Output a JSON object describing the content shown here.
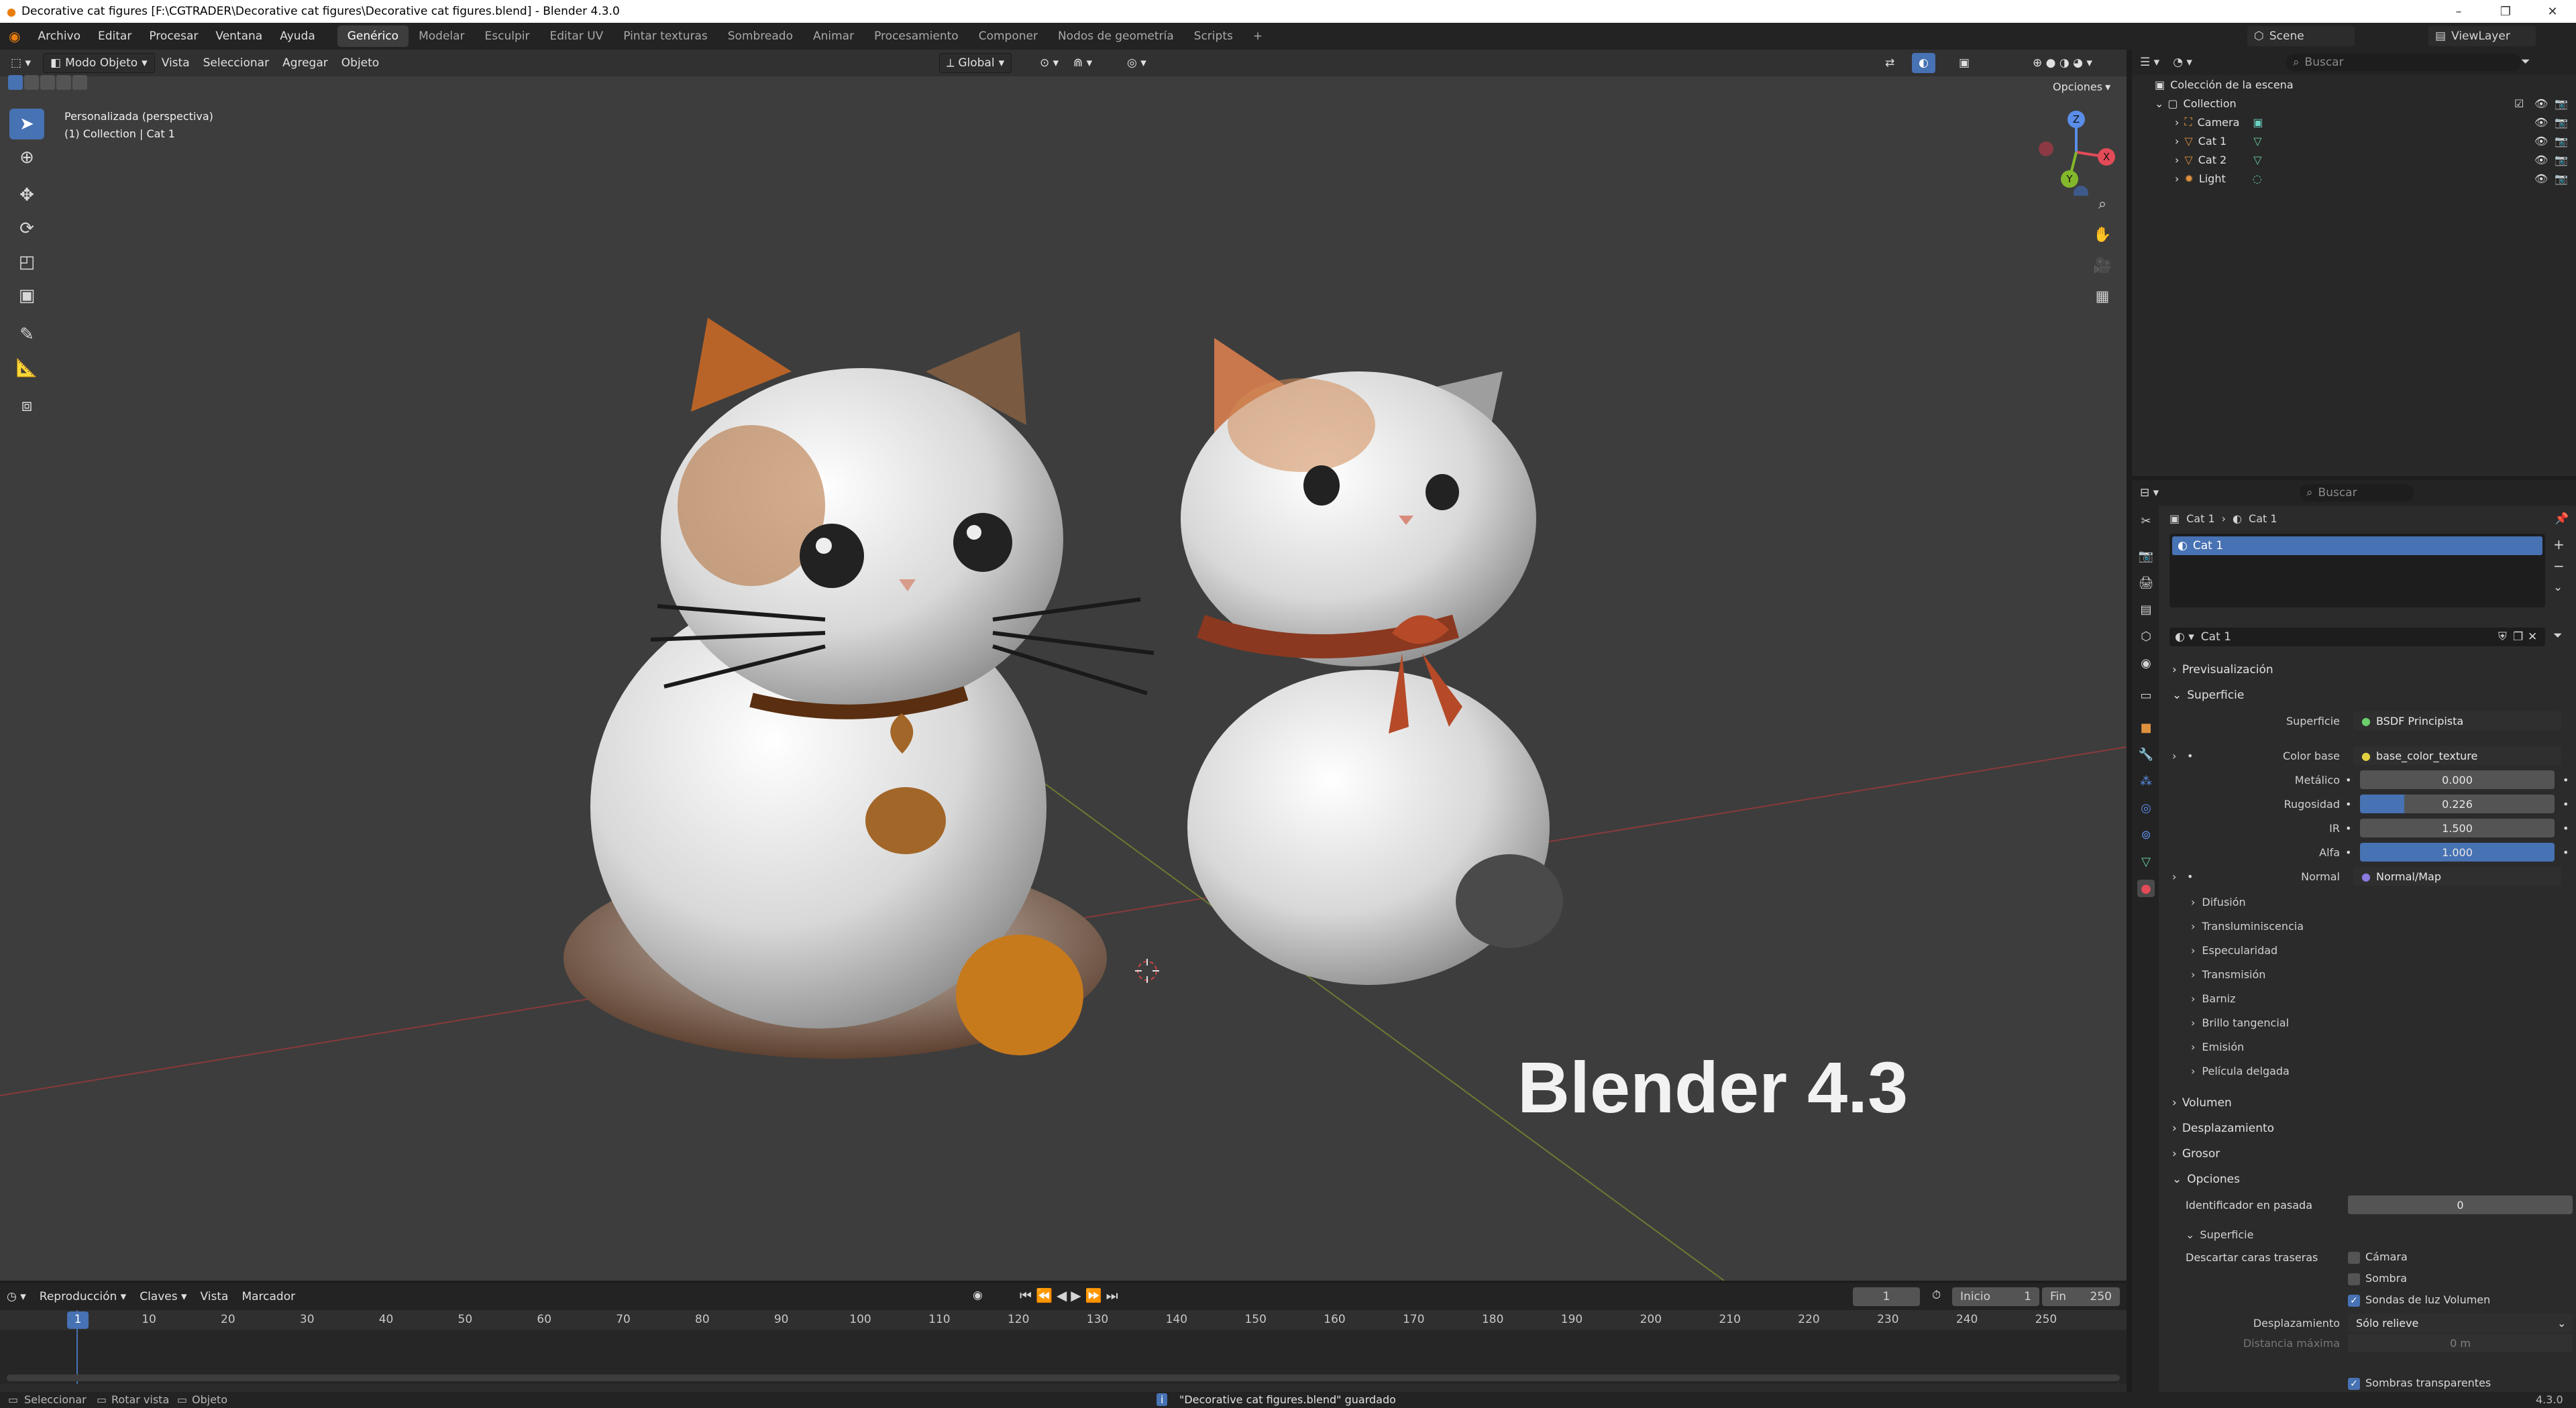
{
  "window": {
    "title": "Decorative cat figures [F:\\CGTRADER\\Decorative cat figures\\Decorative cat figures.blend] - Blender 4.3.0",
    "controls": [
      "–",
      "❐",
      "✕"
    ]
  },
  "menu": {
    "items": [
      "Archivo",
      "Editar",
      "Procesar",
      "Ventana",
      "Ayuda"
    ],
    "workspaces": [
      "Genérico",
      "Modelar",
      "Esculpir",
      "Editar UV",
      "Pintar texturas",
      "Sombreado",
      "Animar",
      "Procesamiento",
      "Componer",
      "Nodos de geometría",
      "Scripts"
    ],
    "active_workspace": "Genérico",
    "add_workspace": "+",
    "scene": "Scene",
    "view_layer": "ViewLayer"
  },
  "viewport": {
    "mode": "Modo Objeto",
    "menus": [
      "Vista",
      "Seleccionar",
      "Agregar",
      "Objeto"
    ],
    "orientation": "Global",
    "options_label": "Opciones",
    "view_name": "Personalizada (perspectiva)",
    "collection_info": "(1) Collection | Cat 1",
    "overlay_text": "Blender 4.3",
    "gizmo_axes": [
      "Z",
      "X",
      "Y"
    ]
  },
  "outliner": {
    "search_placeholder": "Buscar",
    "root": "Colección de la escena",
    "collection": "Collection",
    "items": [
      {
        "name": "Camera",
        "icon": "camera-icon",
        "color": "#e0913e"
      },
      {
        "name": "Cat 1",
        "icon": "mesh-icon",
        "color": "#e0913e"
      },
      {
        "name": "Cat 2",
        "icon": "mesh-icon",
        "color": "#e0913e"
      },
      {
        "name": "Light",
        "icon": "light-icon",
        "color": "#e0913e"
      }
    ]
  },
  "properties": {
    "search_placeholder": "Buscar",
    "breadcrumb": [
      "Cat 1",
      "Cat 1"
    ],
    "slot": "Cat 1",
    "material_name": "Cat 1",
    "sections": {
      "preview": "Previsualización",
      "surface": "Superficie",
      "volume": "Volumen",
      "displacement": "Desplazamiento",
      "thickness": "Grosor",
      "options": "Opciones"
    },
    "surface": {
      "shader_label": "Superficie",
      "shader_value": "BSDF Principista",
      "base_color_label": "Color base",
      "base_color_value": "base_color_texture",
      "metallic_label": "Metálico",
      "metallic_value": "0.000",
      "roughness_label": "Rugosidad",
      "roughness_value": "0.226",
      "roughness_fill": 0.226,
      "ior_label": "IR",
      "ior_value": "1.500",
      "alpha_label": "Alfa",
      "alpha_value": "1.000",
      "alpha_fill": 1.0,
      "normal_label": "Normal",
      "normal_value": "Normal/Map"
    },
    "subpanels": [
      "Difusión",
      "Transluminiscencia",
      "Especularidad",
      "Transmisión",
      "Barniz",
      "Brillo tangencial",
      "Emisión",
      "Película delgada"
    ],
    "options": {
      "pass_index_label": "Identificador en pasada",
      "pass_index_value": "0",
      "surface_sub": "Superficie",
      "backface_label": "Descartar caras traseras",
      "camera_label": "Cámara",
      "shadow_label": "Sombra",
      "light_probe_label": "Sondas de luz Volumen",
      "displacement_label": "Desplazamiento",
      "displacement_value": "Sólo relieve",
      "max_distance_label": "Distancia máxima",
      "max_distance_value": "0 m",
      "transparent_shadows_label": "Sombras transparentes"
    }
  },
  "timeline": {
    "menus": [
      "Reproducción",
      "Claves",
      "Vista",
      "Marcador"
    ],
    "current_frame": "1",
    "start_label": "Inicio",
    "start_value": "1",
    "end_label": "Fin",
    "end_value": "250",
    "ticks": [
      "1",
      "10",
      "20",
      "30",
      "40",
      "50",
      "60",
      "70",
      "80",
      "90",
      "100",
      "110",
      "120",
      "130",
      "140",
      "150",
      "160",
      "170",
      "180",
      "190",
      "200",
      "210",
      "220",
      "230",
      "240",
      "250"
    ]
  },
  "status": {
    "select": "Seleccionar",
    "rotate": "Rotar vista",
    "object": "Objeto",
    "message": "\"Decorative cat figures.blend\" guardado",
    "version": "4.3.0"
  },
  "colors": {
    "accent": "#4772b3",
    "viewport_bg": "#3d3d3d",
    "panel_bg": "#2b2b2b"
  }
}
